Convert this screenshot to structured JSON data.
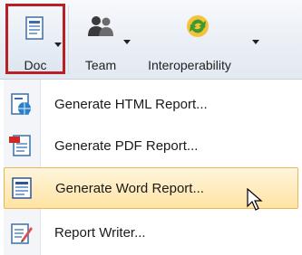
{
  "toolbar": {
    "doc_label": "Doc",
    "team_label": "Team",
    "interop_label": "Interoperability"
  },
  "menu": {
    "items": [
      {
        "label": "Generate HTML Report...",
        "icon": "html-report-icon"
      },
      {
        "label": "Generate PDF Report...",
        "icon": "pdf-report-icon"
      },
      {
        "label": "Generate Word Report...",
        "icon": "word-report-icon",
        "highlighted": true
      },
      {
        "label": "Report Writer...",
        "icon": "report-writer-icon"
      }
    ]
  },
  "colors": {
    "selected_border": "#b72025",
    "hover_fill": "#ffe3a3",
    "hover_border": "#e7b75a"
  }
}
